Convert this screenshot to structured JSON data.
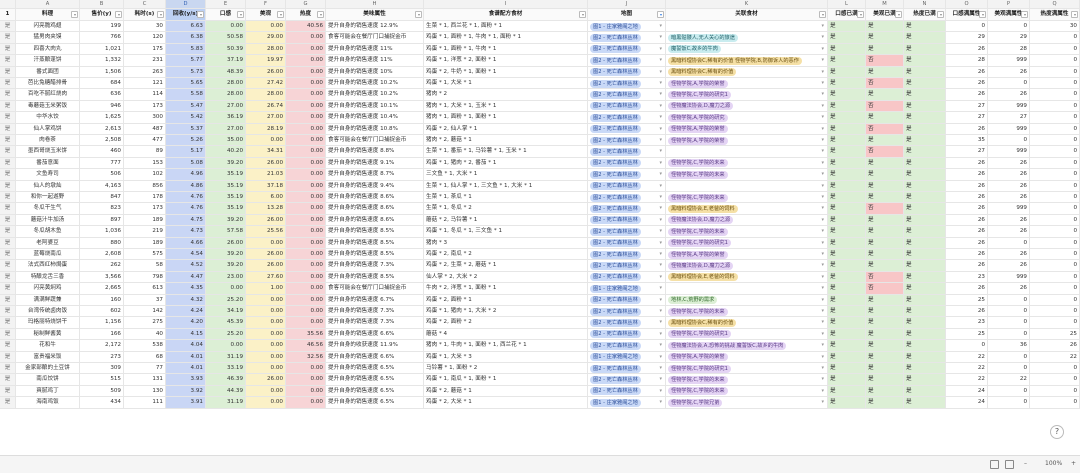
{
  "columns": [
    "A",
    "B",
    "C",
    "D",
    "E",
    "F",
    "G",
    "H",
    "I",
    "J",
    "K",
    "L",
    "M",
    "N",
    "O",
    "P",
    "Q"
  ],
  "headers": [
    "料理",
    "售价(y)",
    "耗时(s)",
    "回收(y/s)",
    "口感",
    "美观",
    "热度",
    "美味属性",
    "食谱配方食材",
    "地图",
    "关联食材",
    "口感已满",
    "美观已满",
    "热度已满",
    "口感满属性",
    "美观满属性",
    "热度满属性"
  ],
  "rows": [
    {
      "n": "是",
      "a": "闪亮脆鸡翅",
      "b": "199",
      "c": "30",
      "d": "6.63",
      "e": "0.00",
      "f": "0.00",
      "g": "40.56",
      "h": "提升自身的销售速度 12.9%",
      "i": "生菜 * 1, 西兰花 * 1, 面粉 * 1",
      "j": "图1 - 庄家雅阁之地",
      "k": "",
      "l": "是",
      "m": "是",
      "o": "0",
      "p": "0",
      "q": "30"
    },
    {
      "n": "是",
      "a": "猛男肉夹馍",
      "b": "766",
      "c": "120",
      "d": "6.38",
      "e": "50.58",
      "f": "29.00",
      "g": "0.00",
      "h": "食客可能会在餐厅门口捕捉金币",
      "i": "鸡蛋 * 1, 面粉 * 1, 牛肉 * 1, 面粉 * 1",
      "j": "图2 - 死亡森林丛林",
      "k": "暗黑骷髅人,无人关心的旅途",
      "l": "是",
      "m": "是",
      "o": "29",
      "p": "29",
      "q": "0"
    },
    {
      "n": "是",
      "a": "四喜大肉丸",
      "b": "1,021",
      "c": "175",
      "d": "5.83",
      "e": "50.39",
      "f": "28.00",
      "g": "0.00",
      "h": "提升自身的销售速度 11%",
      "i": "鸡蛋 * 1, 面粉 * 1, 牛肉 * 1",
      "j": "图2 - 死亡森林丛林",
      "k": "魔誓饭C,故乡的牛肉",
      "l": "是",
      "m": "是",
      "o": "26",
      "p": "28",
      "q": "0"
    },
    {
      "n": "是",
      "a": "汗蒸酿蓬饼",
      "b": "1,332",
      "c": "231",
      "d": "5.77",
      "e": "37.19",
      "f": "19.97",
      "g": "0.00",
      "h": "提升自身的销售速度 11%",
      "i": "鸡蛋 * 1, 洋葱 * 2, 面粉 * 1",
      "j": "图2 - 死亡森林丛林",
      "k": "黑暗料理协会C,稀有的价值    怪物学院,B,防御诉人的恶作",
      "l": "是",
      "m": "否",
      "o": "28",
      "p": "999",
      "q": "0"
    },
    {
      "n": "是",
      "a": "番式面团",
      "b": "1,506",
      "c": "263",
      "d": "5.73",
      "e": "48.39",
      "f": "26.00",
      "g": "0.00",
      "h": "提升自身的销售速度 10%",
      "i": "鸡蛋 * 2, 牛奶 * 1, 面粉 * 1",
      "j": "图2 - 死亡森林丛林",
      "k": "黑暗料理协会C,稀有的价值",
      "l": "是",
      "m": "是",
      "o": "26",
      "p": "26",
      "q": "0"
    },
    {
      "n": "是",
      "a": "芭比兔糖醋排骨",
      "b": "684",
      "c": "121",
      "d": "5.65",
      "e": "28.00",
      "f": "27.42",
      "g": "0.00",
      "h": "提升自身的销售速度 10.2%",
      "i": "鸡蛋 * 1, 大米 * 1",
      "j": "图2 - 死亡森林丛林",
      "k": "怪物学院,A,学院的荣誉",
      "l": "是",
      "m": "否",
      "o": "26",
      "p": "0",
      "q": "0"
    },
    {
      "n": "是",
      "a": "百吃不腻红烧肉",
      "b": "636",
      "c": "114",
      "d": "5.58",
      "e": "28.00",
      "f": "28.00",
      "g": "0.00",
      "h": "提升自身的销售速度 10.2%",
      "i": "猪肉 * 2",
      "j": "图2 - 死亡森林丛林",
      "k": "怪物学院,C,学院的研究1",
      "l": "是",
      "m": "是",
      "o": "26",
      "p": "26",
      "q": "0"
    },
    {
      "n": "是",
      "a": "毒蘑菇玉米粥饭",
      "b": "946",
      "c": "173",
      "d": "5.47",
      "e": "27.00",
      "f": "26.74",
      "g": "0.00",
      "h": "提升自身的销售速度 10.1%",
      "i": "猪肉 * 1, 大米 * 1, 玉米 * 1",
      "j": "图2 - 死亡森林丛林",
      "k": "怪物魔法协会,D,魔力之源",
      "l": "是",
      "m": "否",
      "o": "27",
      "p": "999",
      "q": "0"
    },
    {
      "n": "是",
      "a": "中华水饺",
      "b": "1,625",
      "c": "300",
      "d": "5.42",
      "e": "36.19",
      "f": "27.00",
      "g": "0.00",
      "h": "提升自身的销售速度 10.4%",
      "i": "猪肉 * 1, 面粉 * 1, 面粉 * 1",
      "j": "图2 - 死亡森林丛林",
      "k": "怪物学院,A,学院的研究",
      "l": "是",
      "m": "是",
      "o": "27",
      "p": "27",
      "q": "0"
    },
    {
      "n": "是",
      "a": "仙人掌鸡饼",
      "b": "2,613",
      "c": "487",
      "d": "5.37",
      "e": "27.00",
      "f": "28.19",
      "g": "0.00",
      "h": "提升自身的销售速度 10.8%",
      "i": "鸡蛋 * 2, 仙人掌 * 1",
      "j": "图2 - 死亡森林丛林",
      "k": "怪物学院,A,学院的荣誉",
      "l": "是",
      "m": "否",
      "o": "26",
      "p": "999",
      "q": "0"
    },
    {
      "n": "是",
      "a": "肉卷茶",
      "b": "2,508",
      "c": "477",
      "d": "5.26",
      "e": "35.00",
      "f": "0.00",
      "g": "0.00",
      "h": "食客可能会在餐厅门口捕捉金币",
      "i": "猪肉 * 2, 蘑菇 * 1",
      "j": "图2 - 死亡森林丛林",
      "k": "怪物学院,A,学院的荣誉",
      "l": "是",
      "m": "是",
      "o": "35",
      "p": "0",
      "q": "0"
    },
    {
      "n": "是",
      "a": "墨西哥烧玉米饼",
      "b": "460",
      "c": "89",
      "d": "5.17",
      "e": "40.20",
      "f": "34.31",
      "g": "0.00",
      "h": "提升自身的销售速度 8.8%",
      "i": "生菜 * 1, 番茄 * 1, 马铃薯 * 1, 玉米 * 1",
      "j": "图2 - 死亡森林丛林",
      "k": "",
      "l": "是",
      "m": "否",
      "o": "27",
      "p": "999",
      "q": "0"
    },
    {
      "n": "是",
      "a": "番茄意面",
      "b": "777",
      "c": "153",
      "d": "5.08",
      "e": "39.20",
      "f": "26.00",
      "g": "0.00",
      "h": "提升自身的销售速度 9.1%",
      "i": "鸡蛋 * 1, 猪肉 * 2, 番茄 * 1",
      "j": "图2 - 死亡森林丛林",
      "k": "怪物学院,C,学院的未来",
      "l": "是",
      "m": "是",
      "o": "26",
      "p": "26",
      "q": "0"
    },
    {
      "n": "是",
      "a": "文鱼寿司",
      "b": "506",
      "c": "102",
      "d": "4.96",
      "e": "35.19",
      "f": "21.03",
      "g": "0.00",
      "h": "提升自身的销售速度 8.7%",
      "i": "三文鱼 * 1, 大米 * 1",
      "j": "图2 - 死亡森林丛林",
      "k": "怪物学院,C,学院的未来",
      "l": "是",
      "m": "是",
      "o": "26",
      "p": "26",
      "q": "0"
    },
    {
      "n": "是",
      "a": "仙人的墩灿",
      "b": "4,163",
      "c": "856",
      "d": "4.86",
      "e": "35.19",
      "f": "37.18",
      "g": "0.00",
      "h": "提升自身的销售速度 9.4%",
      "i": "生菜 * 1, 仙人掌 * 1, 三文鱼 * 1, 大米 * 1",
      "j": "图2 - 死亡森林丛林",
      "k": "",
      "l": "是",
      "m": "是",
      "o": "26",
      "p": "26",
      "q": "0"
    },
    {
      "n": "是",
      "a": "和你一起遊野",
      "b": "847",
      "c": "178",
      "d": "4.76",
      "e": "35.19",
      "f": "6.00",
      "g": "0.00",
      "h": "提升自身的销售速度 8.6%",
      "i": "生菜 * 1, 茶瓜 * 1",
      "j": "图2 - 死亡森林丛林",
      "k": "怪物学院,C,学院的未来",
      "l": "是",
      "m": "是",
      "o": "26",
      "p": "26",
      "q": "0"
    },
    {
      "n": "是",
      "a": "冬瓜干生气",
      "b": "823",
      "c": "173",
      "d": "4.76",
      "e": "35.19",
      "f": "13.28",
      "g": "0.00",
      "h": "提升自身的销售速度 8.6%",
      "i": "生菜 * 1, 冬瓜 * 2",
      "j": "图2 - 死亡森林丛林",
      "k": "黑暗料理协会,E,老爸的饲料",
      "l": "是",
      "m": "否",
      "o": "26",
      "p": "999",
      "q": "0"
    },
    {
      "n": "是",
      "a": "蘑菇汁牛加汤",
      "b": "897",
      "c": "189",
      "d": "4.75",
      "e": "39.20",
      "f": "26.00",
      "g": "0.00",
      "h": "提升自身的销售速度 8.6%",
      "i": "蘑菇 * 2, 马铃薯 * 1",
      "j": "图2 - 死亡森林丛林",
      "k": "怪物魔法协会,D,魔力之源",
      "l": "是",
      "m": "是",
      "o": "26",
      "p": "26",
      "q": "0"
    },
    {
      "n": "是",
      "a": "冬瓜胡木鱼",
      "b": "1,036",
      "c": "219",
      "d": "4.73",
      "e": "57.58",
      "f": "25.56",
      "g": "0.00",
      "h": "提升自身的销售速度 8.5%",
      "i": "鸡蛋 * 1, 冬瓜 * 1, 三文鱼 * 1",
      "j": "图2 - 死亡森林丛林",
      "k": "怪物学院,C,学院的未来",
      "l": "是",
      "m": "是",
      "o": "26",
      "p": "26",
      "q": "0"
    },
    {
      "n": "是",
      "a": "老阿婆豆",
      "b": "880",
      "c": "189",
      "d": "4.66",
      "e": "26.00",
      "f": "0.00",
      "g": "0.00",
      "h": "提升自身的销售速度 8.5%",
      "i": "猪肉 * 3",
      "j": "图2 - 死亡森林丛林",
      "k": "怪物学院,C,学院的研究1",
      "l": "是",
      "m": "是",
      "o": "26",
      "p": "0",
      "q": "0"
    },
    {
      "n": "是",
      "a": "蓝莓烧南瓜",
      "b": "2,608",
      "c": "575",
      "d": "4.54",
      "e": "39.20",
      "f": "26.00",
      "g": "0.00",
      "h": "提升自身的销售速度 8.5%",
      "i": "鸡蛋 * 2, 南瓜 * 2",
      "j": "图2 - 死亡森林丛林",
      "k": "怪物学院,A,学院的荣誉",
      "l": "是",
      "m": "是",
      "o": "26",
      "p": "26",
      "q": "0"
    },
    {
      "n": "是",
      "a": "法式西红柿焗蛋",
      "b": "262",
      "c": "58",
      "d": "4.52",
      "e": "39.20",
      "f": "26.00",
      "g": "0.00",
      "h": "提升自身的销售速度 7.3%",
      "i": "鸡蛋 * 2, 生菜 * 2, 蘑菇 * 1",
      "j": "图2 - 死亡森林丛林",
      "k": "怪物魔法协会,D,魔力之源",
      "l": "是",
      "m": "是",
      "o": "26",
      "p": "26",
      "q": "0"
    },
    {
      "n": "是",
      "a": "特酿龙舌三香",
      "b": "3,566",
      "c": "798",
      "d": "4.47",
      "e": "23.00",
      "f": "27.60",
      "g": "0.00",
      "h": "提升自身的销售速度 8.5%",
      "i": "仙人掌 * 2, 大米 * 2",
      "j": "图2 - 死亡森林丛林",
      "k": "黑暗料理协会,E,老爸的饲料",
      "l": "是",
      "m": "否",
      "o": "23",
      "p": "999",
      "q": "0"
    },
    {
      "n": "是",
      "a": "闪亮黄焖鸡",
      "b": "2,665",
      "c": "613",
      "d": "4.35",
      "e": "0.00",
      "f": "1.00",
      "g": "0.00",
      "h": "食客可能会在餐厅门口捕捉金币",
      "i": "牛肉 * 2, 洋葱 * 1, 面粉 * 1",
      "j": "图1 - 庄家雅阁之地",
      "k": "",
      "l": "是",
      "m": "否",
      "o": "26",
      "p": "26",
      "q": "0"
    },
    {
      "n": "是",
      "a": "满满鲜蔬兼",
      "b": "160",
      "c": "37",
      "d": "4.32",
      "e": "25.20",
      "f": "0.00",
      "g": "0.00",
      "h": "提升自身的销售速度 6.7%",
      "i": "鸡蛋 * 2, 面粉 * 1",
      "j": "图2 - 死亡森林丛林",
      "k": "地林,C,荒野的需求",
      "l": "是",
      "m": "是",
      "o": "25",
      "p": "0",
      "q": "0"
    },
    {
      "n": "是",
      "a": "台湾传统卤肉饭",
      "b": "602",
      "c": "142",
      "d": "4.24",
      "e": "34.19",
      "f": "0.00",
      "g": "0.00",
      "h": "提升自身的销售速度 7.3%",
      "i": "鸡蛋 * 1, 猪肉 * 1, 大米 * 2",
      "j": "图2 - 死亡森林丛林",
      "k": "怪物学院,C,学院的未来",
      "l": "是",
      "m": "是",
      "o": "26",
      "p": "0",
      "q": "0"
    },
    {
      "n": "是",
      "a": "玛格丽特烧饼干",
      "b": "1,156",
      "c": "275",
      "d": "4.20",
      "e": "45.39",
      "f": "0.00",
      "g": "0.00",
      "h": "提升自身的销售速度 7.3%",
      "i": "鸡蛋 * 2, 面粉 * 2",
      "j": "图2 - 死亡森林丛林",
      "k": "黑暗料理协会C,稀有的价值",
      "l": "是",
      "m": "是",
      "o": "23",
      "p": "0",
      "q": "0"
    },
    {
      "n": "是",
      "a": "秘制鲜酱黄",
      "b": "166",
      "c": "40",
      "d": "4.15",
      "e": "25.20",
      "f": "0.00",
      "g": "35.56",
      "h": "提升自身的销售速度 6.6%",
      "i": "蘑菇 * 4",
      "j": "图2 - 死亡森林丛林",
      "k": "怪物学院,C,学院的研究1",
      "l": "是",
      "m": "是",
      "o": "25",
      "p": "0",
      "q": "25"
    },
    {
      "n": "是",
      "a": "花和牛",
      "b": "2,172",
      "c": "538",
      "d": "4.04",
      "e": "0.00",
      "f": "0.00",
      "g": "46.56",
      "h": "提升自身的收获速度 11.9%",
      "i": "猪肉 * 1, 牛肉 * 1, 面粉 * 1, 西兰花 * 1",
      "j": "图2 - 死亡森林丛林",
      "k": "怪物魔法协会,A,恐怖的挑战    魔誓饭C,故乡的牛肉",
      "l": "是",
      "m": "是",
      "o": "0",
      "p": "36",
      "q": "26"
    },
    {
      "n": "是",
      "a": "富贵福米饭",
      "b": "273",
      "c": "68",
      "d": "4.01",
      "e": "31.19",
      "f": "0.00",
      "g": "32.56",
      "h": "提升自身的销售速度 6.6%",
      "i": "鸡蛋 * 1, 大米 * 3",
      "j": "图1 - 庄家雅阁之地",
      "k": "怪物学院,A,学院的荣誉",
      "l": "是",
      "m": "是",
      "o": "22",
      "p": "0",
      "q": "22"
    },
    {
      "n": "是",
      "a": "金家部酿的土豆饼",
      "b": "309",
      "c": "77",
      "d": "4.01",
      "e": "33.19",
      "f": "0.00",
      "g": "0.00",
      "h": "提升自身的销售速度 6.5%",
      "i": "马铃薯 * 1, 面粉 * 2",
      "j": "图2 - 死亡森林丛林",
      "k": "怪物学院,C,学院的研究1",
      "l": "是",
      "m": "是",
      "o": "22",
      "p": "0",
      "q": "0"
    },
    {
      "n": "是",
      "a": "南瓜饺饼",
      "b": "515",
      "c": "131",
      "d": "3.93",
      "e": "46.39",
      "f": "26.00",
      "g": "0.00",
      "h": "提升自身的销售速度 6.5%",
      "i": "鸡蛋 * 1, 南瓜 * 1, 面粉 * 1",
      "j": "图2 - 死亡森林丛林",
      "k": "怪物学院,C,学院的未来",
      "l": "是",
      "m": "是",
      "o": "22",
      "p": "22",
      "q": "0"
    },
    {
      "n": "是",
      "a": "爽腻鸡丁",
      "b": "509",
      "c": "130",
      "d": "3.92",
      "e": "44.39",
      "f": "0.00",
      "g": "0.00",
      "h": "提升自身的销售速度 6.5%",
      "i": "鸡蛋 * 2, 蘑菇 * 1",
      "j": "图2 - 死亡森林丛林",
      "k": "怪物学院,C,学院的未来",
      "l": "是",
      "m": "是",
      "o": "24",
      "p": "0",
      "q": "0"
    },
    {
      "n": "是",
      "a": "海南鸡饭",
      "b": "434",
      "c": "111",
      "d": "3.91",
      "e": "31.19",
      "f": "0.00",
      "g": "0.00",
      "h": "提升自身的销售速度 6.5%",
      "i": "鸡蛋 * 2, 大米 * 1",
      "j": "图1 - 庄家雅阁之地",
      "k": "怪物学院,C,学院兄弟",
      "l": "是",
      "m": "是",
      "o": "24",
      "p": "0",
      "q": "0"
    }
  ],
  "status": {
    "zoom": "100%",
    "zoom_minus": "–",
    "zoom_plus": "+"
  },
  "colors": {
    "accent": "#2f7be6",
    "header_bg": "#f3f3f3",
    "col_d": "#c9d6f5",
    "col_e": "#dcefd5",
    "col_f": "#fbf1c7",
    "col_g": "#f7d4d6",
    "flag_bad": "#f8c6c7"
  }
}
